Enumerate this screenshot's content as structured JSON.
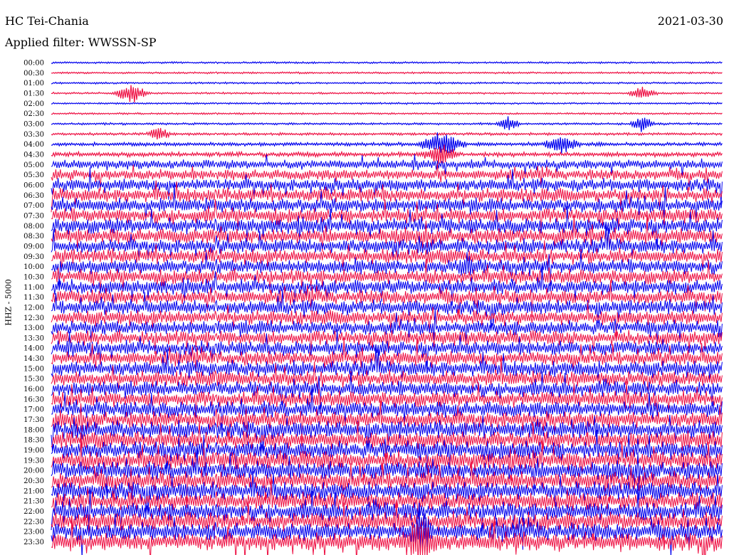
{
  "header": {
    "station": "HC Tei-Chania",
    "date": "2021-03-30",
    "filter": "Applied filter: WWSSN-SP"
  },
  "channel_label": "HHZ - 5000",
  "chart_data": {
    "type": "line",
    "title": "HC Tei-Chania",
    "subtitle": "Applied filter: WWSSN-SP",
    "ylabel": "HHZ - 5000",
    "row_labels": [
      "00:00",
      "00:30",
      "01:00",
      "01:30",
      "02:00",
      "02:30",
      "03:00",
      "03:30",
      "04:00",
      "04:30",
      "05:00",
      "05:30",
      "06:00",
      "06:30",
      "07:00",
      "07:30",
      "08:00",
      "08:30",
      "09:00",
      "09:30",
      "10:00",
      "10:30",
      "11:00",
      "11:30",
      "12:00",
      "12:30",
      "13:00",
      "13:30",
      "14:00",
      "14:30",
      "15:00",
      "15:30",
      "16:00",
      "16:30",
      "17:00",
      "17:30",
      "18:00",
      "18:30",
      "19:00",
      "19:30",
      "20:00",
      "20:30",
      "21:00",
      "21:30",
      "22:00",
      "22:30",
      "23:00",
      "23:30"
    ],
    "series_colors": [
      "#0000ee",
      "#ee1144"
    ],
    "noise_level": [
      1,
      1,
      1,
      1,
      1,
      1,
      1.2,
      1.4,
      2,
      2.5,
      5,
      6,
      7,
      7.5,
      8,
      8,
      8.5,
      8.5,
      8,
      8,
      8,
      8,
      8,
      8,
      8,
      8,
      8,
      8,
      8,
      8,
      8.5,
      8.5,
      8.5,
      8.5,
      9,
      9,
      9.5,
      9.5,
      10,
      10,
      10,
      10,
      10,
      10,
      10,
      10,
      10,
      10
    ],
    "events": [
      {
        "row": 3,
        "x": 0.12,
        "amp": 14,
        "width": 0.03
      },
      {
        "row": 3,
        "x": 0.88,
        "amp": 9,
        "width": 0.025
      },
      {
        "row": 6,
        "x": 0.68,
        "amp": 10,
        "width": 0.02
      },
      {
        "row": 6,
        "x": 0.88,
        "amp": 12,
        "width": 0.02
      },
      {
        "row": 7,
        "x": 0.16,
        "amp": 9,
        "width": 0.02
      },
      {
        "row": 8,
        "x": 0.58,
        "amp": 16,
        "width": 0.04
      },
      {
        "row": 8,
        "x": 0.76,
        "amp": 12,
        "width": 0.03
      },
      {
        "row": 9,
        "x": 0.58,
        "amp": 13,
        "width": 0.03
      },
      {
        "row": 20,
        "x": 0.62,
        "amp": 12,
        "width": 0.02
      },
      {
        "row": 46,
        "x": 0.55,
        "amp": 22,
        "width": 0.02
      },
      {
        "row": 47,
        "x": 0.55,
        "amp": 26,
        "width": 0.03
      }
    ]
  }
}
